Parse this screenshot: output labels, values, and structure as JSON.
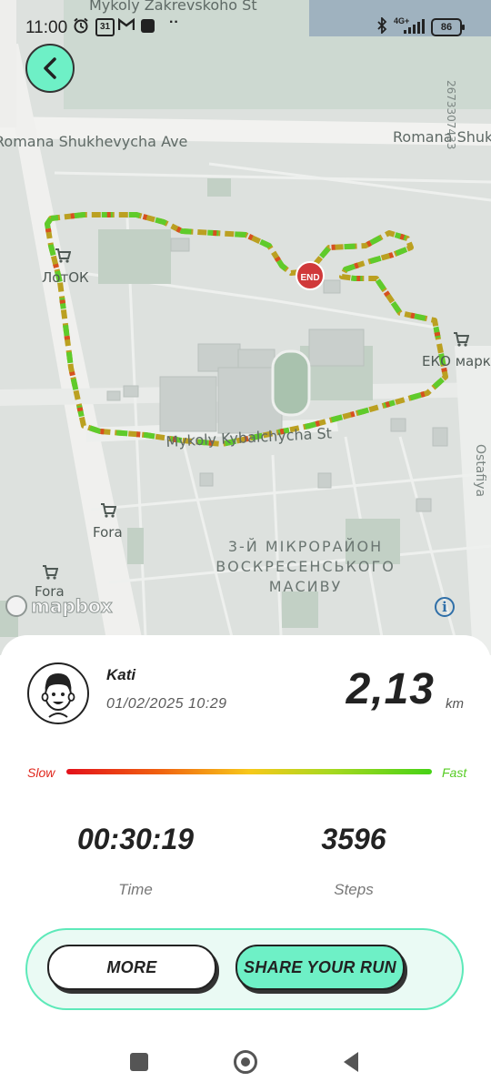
{
  "status_bar": {
    "time": "11:00",
    "calendar_day": "31",
    "network": "4G+",
    "battery": "86"
  },
  "map": {
    "street_labels": [
      "Mykoly Zakrevskoho St",
      "Romana Shukhevycha Ave",
      "Romana Shuk",
      "Mykoly Kybalchycha St",
      "Ostafiya"
    ],
    "vertical_label": "2673307433",
    "poi_labels": [
      "ЛотОК",
      "ЕКО марке",
      "Fora",
      "Fora"
    ],
    "district_label": [
      "3-Й МІКРОРАЙОН",
      "ВОСКРЕСЕНСЬКОГО",
      "МАСИВУ"
    ],
    "end_marker": "END",
    "attribution": "mapbox",
    "info": "i",
    "colors": {
      "route_fast": "#5fcb2b",
      "route_mid": "#d8b417",
      "route_slow": "#d7501f",
      "end_marker": "#d0393a"
    }
  },
  "back_button": {
    "icon": "chevron-left-icon"
  },
  "run": {
    "user_name": "Kati",
    "date": "01/02/2025 10:29",
    "distance": "2,13",
    "distance_unit": "km",
    "pace_slow_label": "Slow",
    "pace_fast_label": "Fast",
    "time_value": "00:30:19",
    "time_label": "Time",
    "steps_value": "3596",
    "steps_label": "Steps"
  },
  "actions": {
    "more_label": "MORE",
    "share_label": "SHARE YOUR RUN",
    "accent": "#6ef0c6"
  },
  "nav_bar": {
    "icons": [
      "recent-apps-icon",
      "home-icon",
      "back-icon"
    ]
  }
}
